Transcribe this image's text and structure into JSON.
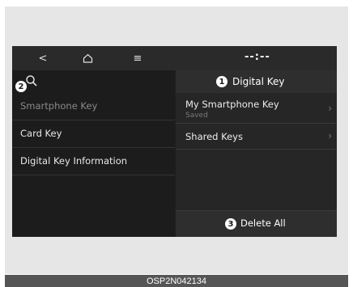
{
  "statusbar": {
    "back_glyph": "<",
    "home_icon": "home-icon",
    "menu_glyph": "≡",
    "clock": "--:--"
  },
  "left": {
    "search_icon": "search-icon",
    "items": [
      {
        "label": "Smartphone Key",
        "state": "dimmed"
      },
      {
        "label": "Card Key",
        "state": "normal"
      },
      {
        "label": "Digital Key Information",
        "state": "normal"
      }
    ]
  },
  "right": {
    "title": "Digital Key",
    "items": [
      {
        "label": "My Smartphone Key",
        "sub": "Saved"
      },
      {
        "label": "Shared Keys",
        "sub": ""
      }
    ],
    "delete_label": "Delete All"
  },
  "callouts": [
    "1",
    "2",
    "3"
  ],
  "caption": "OSP2N042134",
  "colors": {
    "screen_bg": "#1e1e1e",
    "panel_right": "#262626",
    "text_primary": "#ececec",
    "text_dim": "#8a8a8a",
    "caption_bg": "#555555"
  }
}
